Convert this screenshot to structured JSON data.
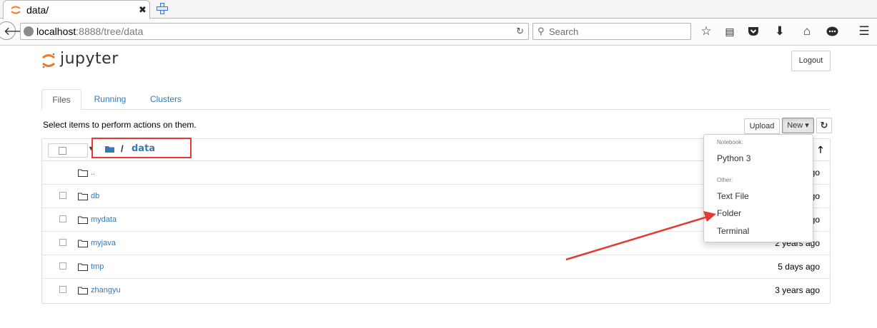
{
  "browser": {
    "tab": {
      "title": "data/",
      "close_glyph": "✖"
    },
    "url": {
      "host": "localhost",
      "rest": ":8888/tree/data"
    },
    "search": {
      "placeholder": "Search"
    },
    "toolbar_icons": [
      "star-icon",
      "reading-list-icon",
      "pocket-icon",
      "download-icon",
      "home-icon",
      "chat-icon",
      "menu-icon"
    ]
  },
  "jupyter": {
    "logo_text": "jupyter",
    "logout_label": "Logout",
    "tabs": [
      {
        "label": "Files",
        "active": true
      },
      {
        "label": "Running",
        "active": false
      },
      {
        "label": "Clusters",
        "active": false
      }
    ],
    "select_hint": "Select items to perform actions on them.",
    "upload_label": "Upload",
    "new_label": "New ▾",
    "breadcrumb": {
      "separator": "/",
      "dir": "data"
    },
    "rows": [
      {
        "name": "..",
        "time": ""
      },
      {
        "name": "db",
        "time": ""
      },
      {
        "name": "mydata",
        "time": ""
      },
      {
        "name": "myjava",
        "time": "2 years ago"
      },
      {
        "name": "tmp",
        "time": "5 days ago"
      },
      {
        "name": "zhangyu",
        "time": "3 years ago"
      }
    ],
    "partial_times": [
      "go",
      "go",
      "go"
    ],
    "dropdown": {
      "notebook_header": "Notebook:",
      "python": "Python 3",
      "other_header": "Other:",
      "text_file": "Text File",
      "folder": "Folder",
      "terminal": "Terminal"
    }
  },
  "colors": {
    "link": "#337ab7",
    "annotation": "#e53935",
    "jupyter_orange": "#f37726"
  }
}
